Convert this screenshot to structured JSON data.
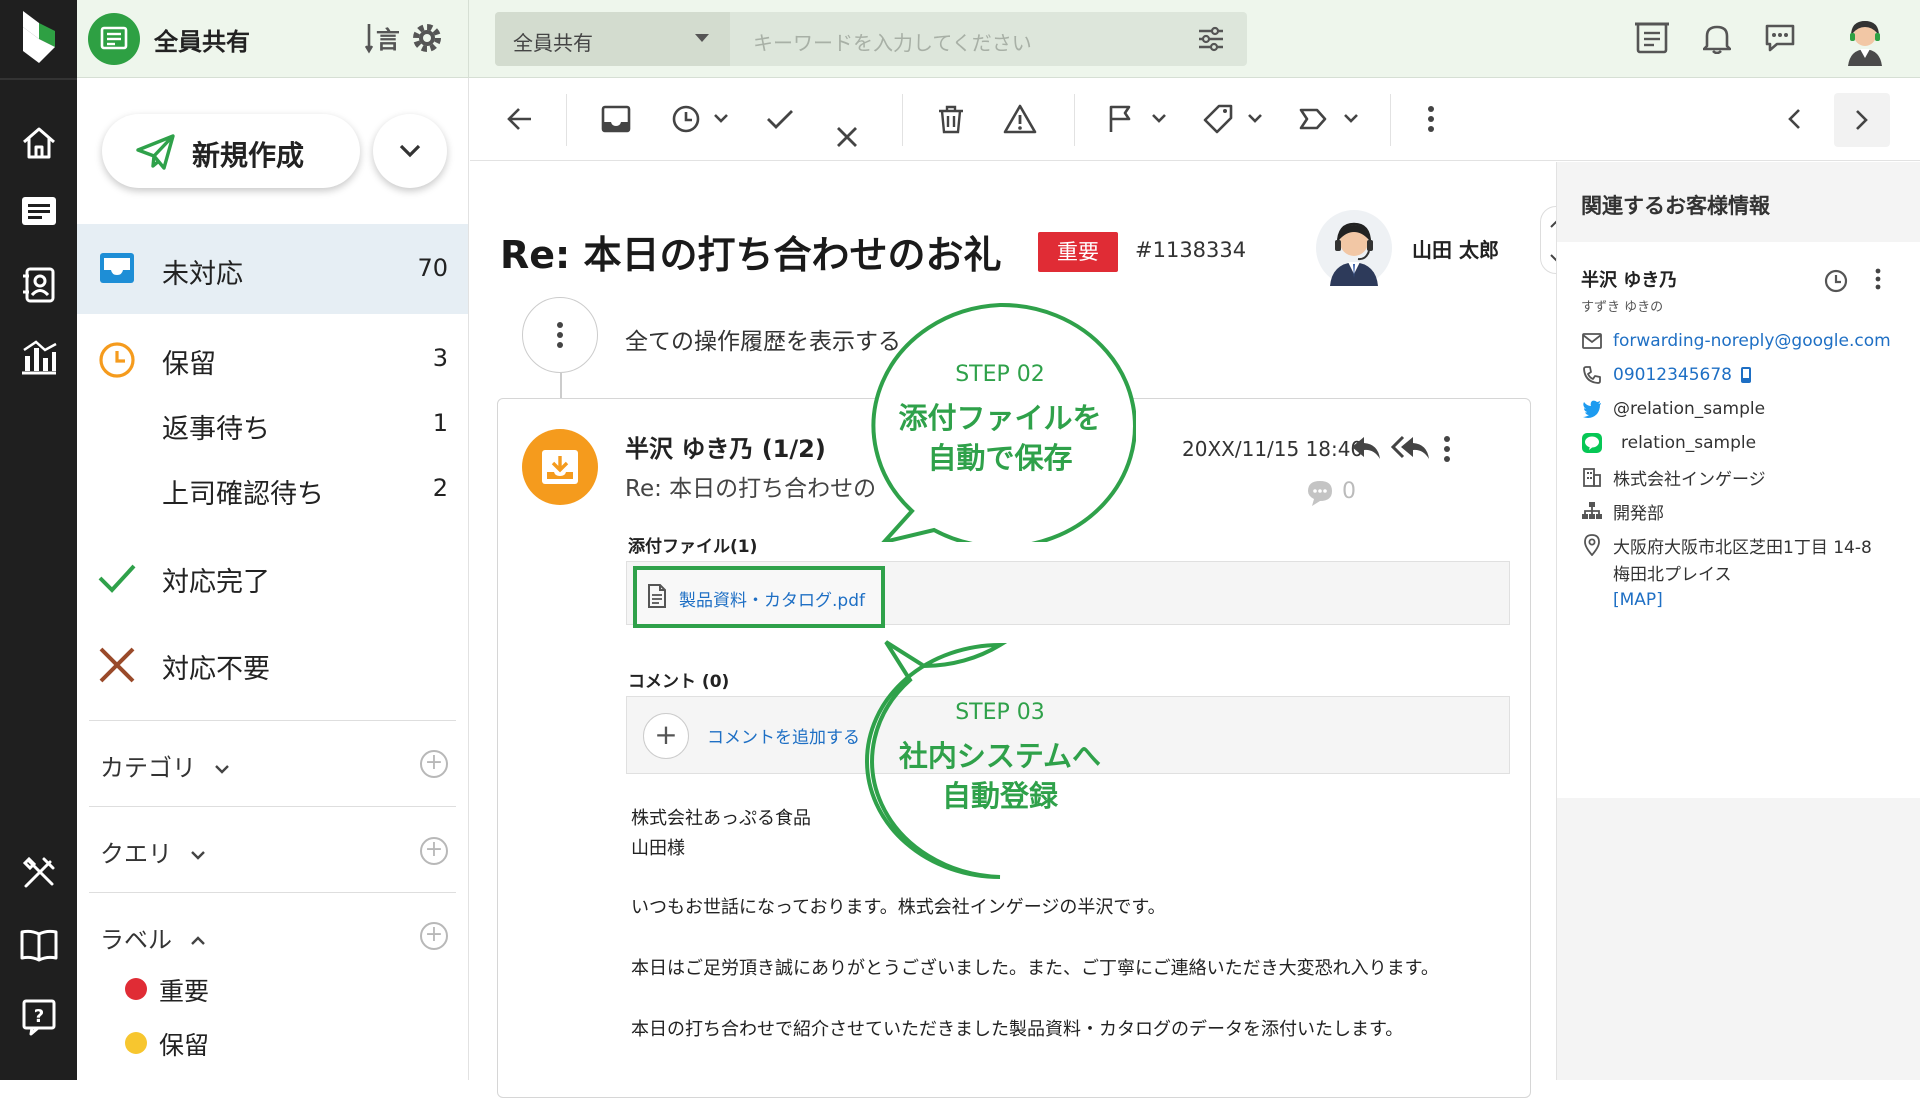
{
  "topbar": {
    "space_name": "全員共有",
    "search_scope": "全員共有",
    "search_placeholder": "キーワードを入力してください"
  },
  "sidebar": {
    "compose_label": "新規作成",
    "items": [
      {
        "label": "未対応",
        "count": "70"
      },
      {
        "label": "保留",
        "count": "3"
      },
      {
        "label": "返事待ち",
        "count": "1"
      },
      {
        "label": "上司確認待ち",
        "count": "2"
      },
      {
        "label": "対応完了",
        "count": ""
      },
      {
        "label": "対応不要",
        "count": ""
      }
    ],
    "sections": {
      "category": "カテゴリ",
      "query": "クエリ",
      "label": "ラベル"
    },
    "labels": [
      {
        "name": "重要",
        "color": "#e02c35"
      },
      {
        "name": "保留",
        "color": "#f7c62f"
      }
    ]
  },
  "ticket": {
    "subject": "Re: 本日の打ち合わせのお礼",
    "tag": "重要",
    "number": "#1138334",
    "assignee": "山田 太郎",
    "history_label": "全ての操作履歴を表示する",
    "message": {
      "sender": "半沢 ゆき乃 (1/2)",
      "subject": "Re: 本日の打ち合わせの",
      "date": "20XX/11/15 18:40",
      "comment_count": "0",
      "attachments_title": "添付ファイル(1)",
      "attachment_name": "製品資料・カタログ.pdf",
      "comments_title": "コメント (0)",
      "add_comment": "コメントを追加する",
      "body": [
        "株式会社あっぷる食品",
        "山田様",
        "いつもお世話になっております。株式会社インゲージの半沢です。",
        "本日はご足労頂き誠にありがとうございました。また、ご丁寧にご連絡いただき大変恐れ入ります。",
        "本日の打ち合わせで紹介させていただきました製品資料・カタログのデータを添付いたします。"
      ]
    }
  },
  "callouts": [
    {
      "step": "STEP 02",
      "line1": "添付ファイルを",
      "line2": "自動で保存"
    },
    {
      "step": "STEP 03",
      "line1": "社内システムへ",
      "line2": "自動登録"
    }
  ],
  "customer_panel": {
    "title": "関連するお客様情報",
    "name": "半沢 ゆき乃",
    "kana": "すずき ゆきの",
    "email": "forwarding-noreply@google.com",
    "phone": "09012345678",
    "twitter": "@relation_sample",
    "line": "relation_sample",
    "company": "株式会社インゲージ",
    "department": "開発部",
    "address_line1": "大阪府大阪市北区芝田1丁目 14-8",
    "address_line2": "梅田北プレイス",
    "map_link": "[MAP]"
  },
  "colors": {
    "accent_green": "#2fa14a",
    "important_red": "#e02c35",
    "pending_orange": "#f59b1d",
    "link_blue": "#1e6fc4"
  }
}
